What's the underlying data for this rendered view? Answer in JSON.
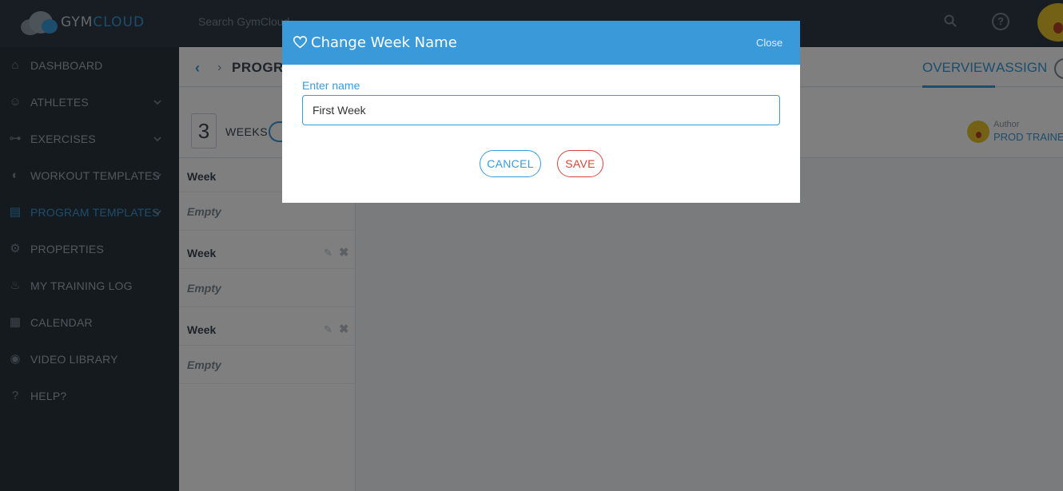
{
  "app": {
    "logo_gym": "GYM",
    "logo_cloud": "CLOUD",
    "search_placeholder": "Search GymCloud",
    "help_icon": "?"
  },
  "sidebar": {
    "items": [
      {
        "label": "DASHBOARD",
        "icon": "home-icon",
        "has_chevron": false
      },
      {
        "label": "ATHLETES",
        "icon": "users-icon",
        "has_chevron": true
      },
      {
        "label": "EXERCISES",
        "icon": "dumbbell-icon",
        "has_chevron": true
      },
      {
        "label": "WORKOUT TEMPLATES",
        "icon": "workout-icon",
        "has_chevron": true
      },
      {
        "label": "PROGRAM TEMPLATES",
        "icon": "clipboard-icon",
        "has_chevron": true,
        "active": true
      },
      {
        "label": "PROPERTIES",
        "icon": "gear-icon",
        "has_chevron": false
      },
      {
        "label": "MY TRAINING LOG",
        "icon": "log-icon",
        "has_chevron": false
      },
      {
        "label": "CALENDAR",
        "icon": "calendar-icon",
        "has_chevron": false
      },
      {
        "label": "VIDEO LIBRARY",
        "icon": "video-icon",
        "has_chevron": false
      },
      {
        "label": "HELP?",
        "icon": "help-icon",
        "has_chevron": false
      }
    ]
  },
  "header": {
    "page_title": "PROGRA",
    "tabs": [
      {
        "label": "OVERVIEW",
        "active": true
      },
      {
        "label": "ASSIGN",
        "active": false
      }
    ]
  },
  "weeks": {
    "count": "3",
    "label": "WEEKS",
    "author_caption": "Author",
    "author_name": "PROD TRAINER",
    "list": [
      {
        "title": "Week",
        "body": "Empty",
        "show_actions": false
      },
      {
        "title": "Week",
        "body": "Empty",
        "show_actions": true
      },
      {
        "title": "Week",
        "body": "Empty",
        "show_actions": true
      }
    ]
  },
  "modal": {
    "title": "Change Week Name",
    "close_label": "Close",
    "field_label": "Enter name",
    "input_value": "First Week",
    "cancel_label": "CANCEL",
    "save_label": "SAVE"
  },
  "colors": {
    "accent": "#3a9ad9",
    "danger": "#d9453a",
    "sidebar_bg": "#2b353e"
  }
}
